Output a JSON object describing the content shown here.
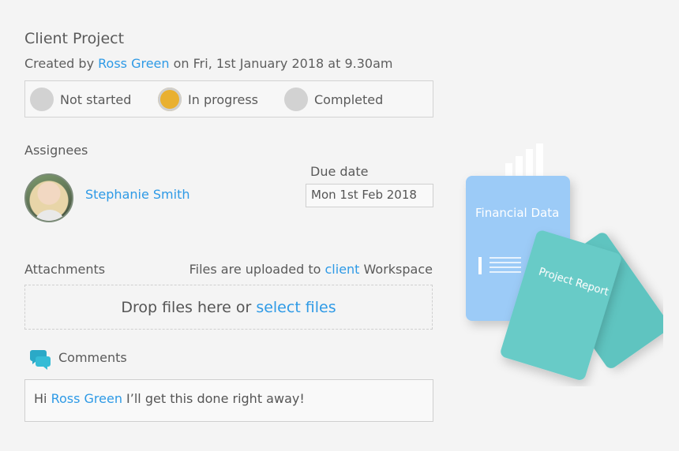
{
  "project": {
    "title": "Client Project",
    "created_prefix": "Created by ",
    "creator": "Ross Green",
    "created_suffix": " on Fri, 1st January 2018 at 9.30am"
  },
  "status": {
    "options": [
      {
        "label": "Not started",
        "active": false
      },
      {
        "label": "In progress",
        "active": true
      },
      {
        "label": "Completed",
        "active": false
      }
    ],
    "active_color": "#e9b030",
    "inactive_color": "#d2d2d2"
  },
  "assignees": {
    "heading": "Assignees",
    "people": [
      {
        "name": "Stephanie Smith"
      }
    ]
  },
  "due": {
    "label": "Due date",
    "value": "Mon 1st Feb 2018"
  },
  "attachments": {
    "heading": "Attachments",
    "info_prefix": "Files are uploaded to ",
    "workspace": "client",
    "info_suffix": " Workspace",
    "drop_prefix": "Drop files here or ",
    "drop_link": "select files"
  },
  "comments": {
    "heading": "Comments",
    "icon": "speech-bubbles-icon",
    "greeting": "Hi ",
    "mention": "Ross Green",
    "text": " I’ll get this done right away!"
  },
  "illustration": {
    "card1_title": "Financial Data",
    "card2_title": "Project Report"
  },
  "colors": {
    "link": "#2e9ae6",
    "card_blue": "#9ccbf7",
    "card_teal": "#67cbc7"
  }
}
